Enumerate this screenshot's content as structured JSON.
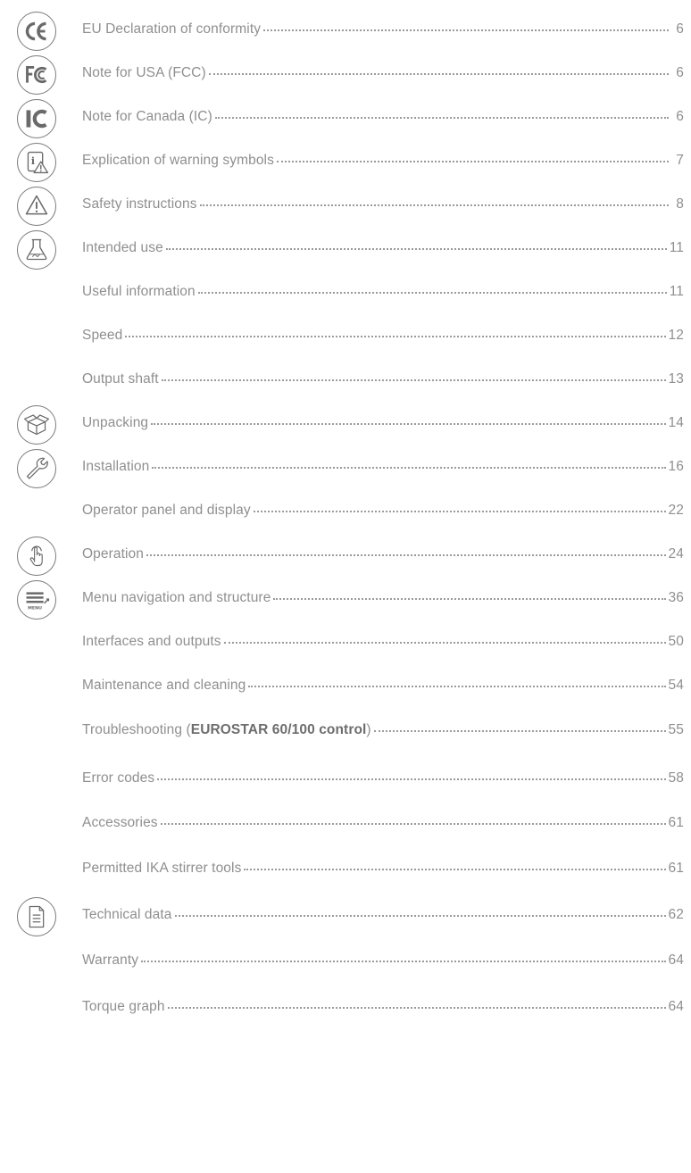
{
  "toc": [
    {
      "title": "EU Declaration of conformity",
      "page": "6",
      "icon": "ce-mark-icon"
    },
    {
      "title": "Note for USA (FCC)",
      "page": "6",
      "icon": "fcc-mark-icon"
    },
    {
      "title": "Note for Canada (IC)",
      "page": "6",
      "icon": "ic-mark-icon"
    },
    {
      "title": "Explication of warning symbols",
      "page": "7",
      "icon": "info-warning-icon"
    },
    {
      "title": "Safety instructions",
      "page": "8",
      "icon": "warning-triangle-icon"
    },
    {
      "title": "Intended use",
      "page": "11",
      "icon": "lab-flask-icon"
    },
    {
      "title": "Useful information",
      "page": "11"
    },
    {
      "title": "Speed",
      "page": "12"
    },
    {
      "title": "Output shaft",
      "page": "13"
    },
    {
      "title": "Unpacking",
      "page": "14",
      "icon": "box-icon"
    },
    {
      "title": "Installation",
      "page": "16",
      "icon": "wrench-icon"
    },
    {
      "title": "Operator panel and display",
      "page": "22"
    },
    {
      "title": "Operation",
      "page": "24",
      "icon": "finger-press-icon"
    },
    {
      "title": "Menu navigation and structure",
      "page": "36",
      "icon": "menu-icon"
    },
    {
      "title": "Interfaces and outputs",
      "page": "50"
    },
    {
      "title": "Maintenance and cleaning",
      "page": "54"
    },
    {
      "title": "Troubleshooting (",
      "title_bold": "EUROSTAR 60/100 control",
      "title_after": ")",
      "page": "55"
    },
    {
      "title": "Error codes",
      "page": "58"
    },
    {
      "title": "Accessories",
      "page": "61"
    },
    {
      "title": "Permitted IKA stirrer tools",
      "page": "61"
    },
    {
      "title": "Technical data",
      "page": "62",
      "icon": "document-icon"
    },
    {
      "title": "Warranty",
      "page": "64"
    },
    {
      "title": "Torque graph",
      "page": "64"
    }
  ],
  "icon_labels": {
    "ce": "CE",
    "fcc": "FC",
    "ic": "IC",
    "menu": "MENU"
  }
}
